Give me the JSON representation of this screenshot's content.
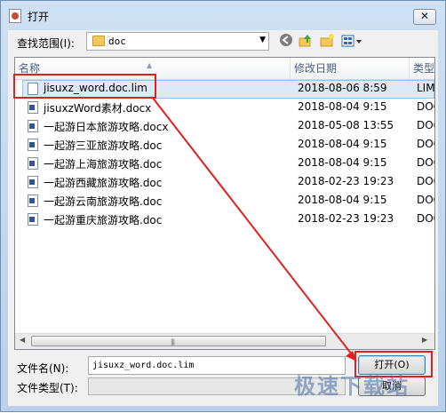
{
  "window": {
    "title": "打开",
    "close_label": "✕"
  },
  "toolbar": {
    "look_in_label": "查找范围(I):",
    "look_in_value": "doc",
    "icons": [
      "back-icon",
      "up-folder-icon",
      "new-folder-icon",
      "view-menu-icon"
    ]
  },
  "columns": {
    "name": "名称",
    "date": "修改日期",
    "type": "类型"
  },
  "files": [
    {
      "name": "jisuxz_word.doc.lim",
      "date": "2018-08-06 8:59",
      "type": "LIM"
    },
    {
      "name": "jisuxzWord素材.docx",
      "date": "2018-08-04 9:15",
      "type": "DOC"
    },
    {
      "name": "一起游日本旅游攻略.docx",
      "date": "2018-05-08 13:55",
      "type": "DOC"
    },
    {
      "name": "一起游三亚旅游攻略.doc",
      "date": "2018-08-04 9:15",
      "type": "DOC"
    },
    {
      "name": "一起游上海旅游攻略.doc",
      "date": "2018-08-04 9:15",
      "type": "DOC"
    },
    {
      "name": "一起游西藏旅游攻略.doc",
      "date": "2018-02-23 19:23",
      "type": "DOC"
    },
    {
      "name": "一起游云南旅游攻略.doc",
      "date": "2018-08-04 9:15",
      "type": "DOC"
    },
    {
      "name": "一起游重庆旅游攻略.doc",
      "date": "2018-02-23 19:23",
      "type": "DOC"
    }
  ],
  "footer": {
    "filename_label": "文件名(N):",
    "filename_value": "jisuxz_word.doc.lim",
    "filetype_label": "文件类型(T):",
    "open_button": "打开(O)",
    "cancel_button": "取消"
  },
  "watermark": "极速下载站",
  "colors": {
    "highlight": "#e02020",
    "selection": "#dceaf8"
  }
}
